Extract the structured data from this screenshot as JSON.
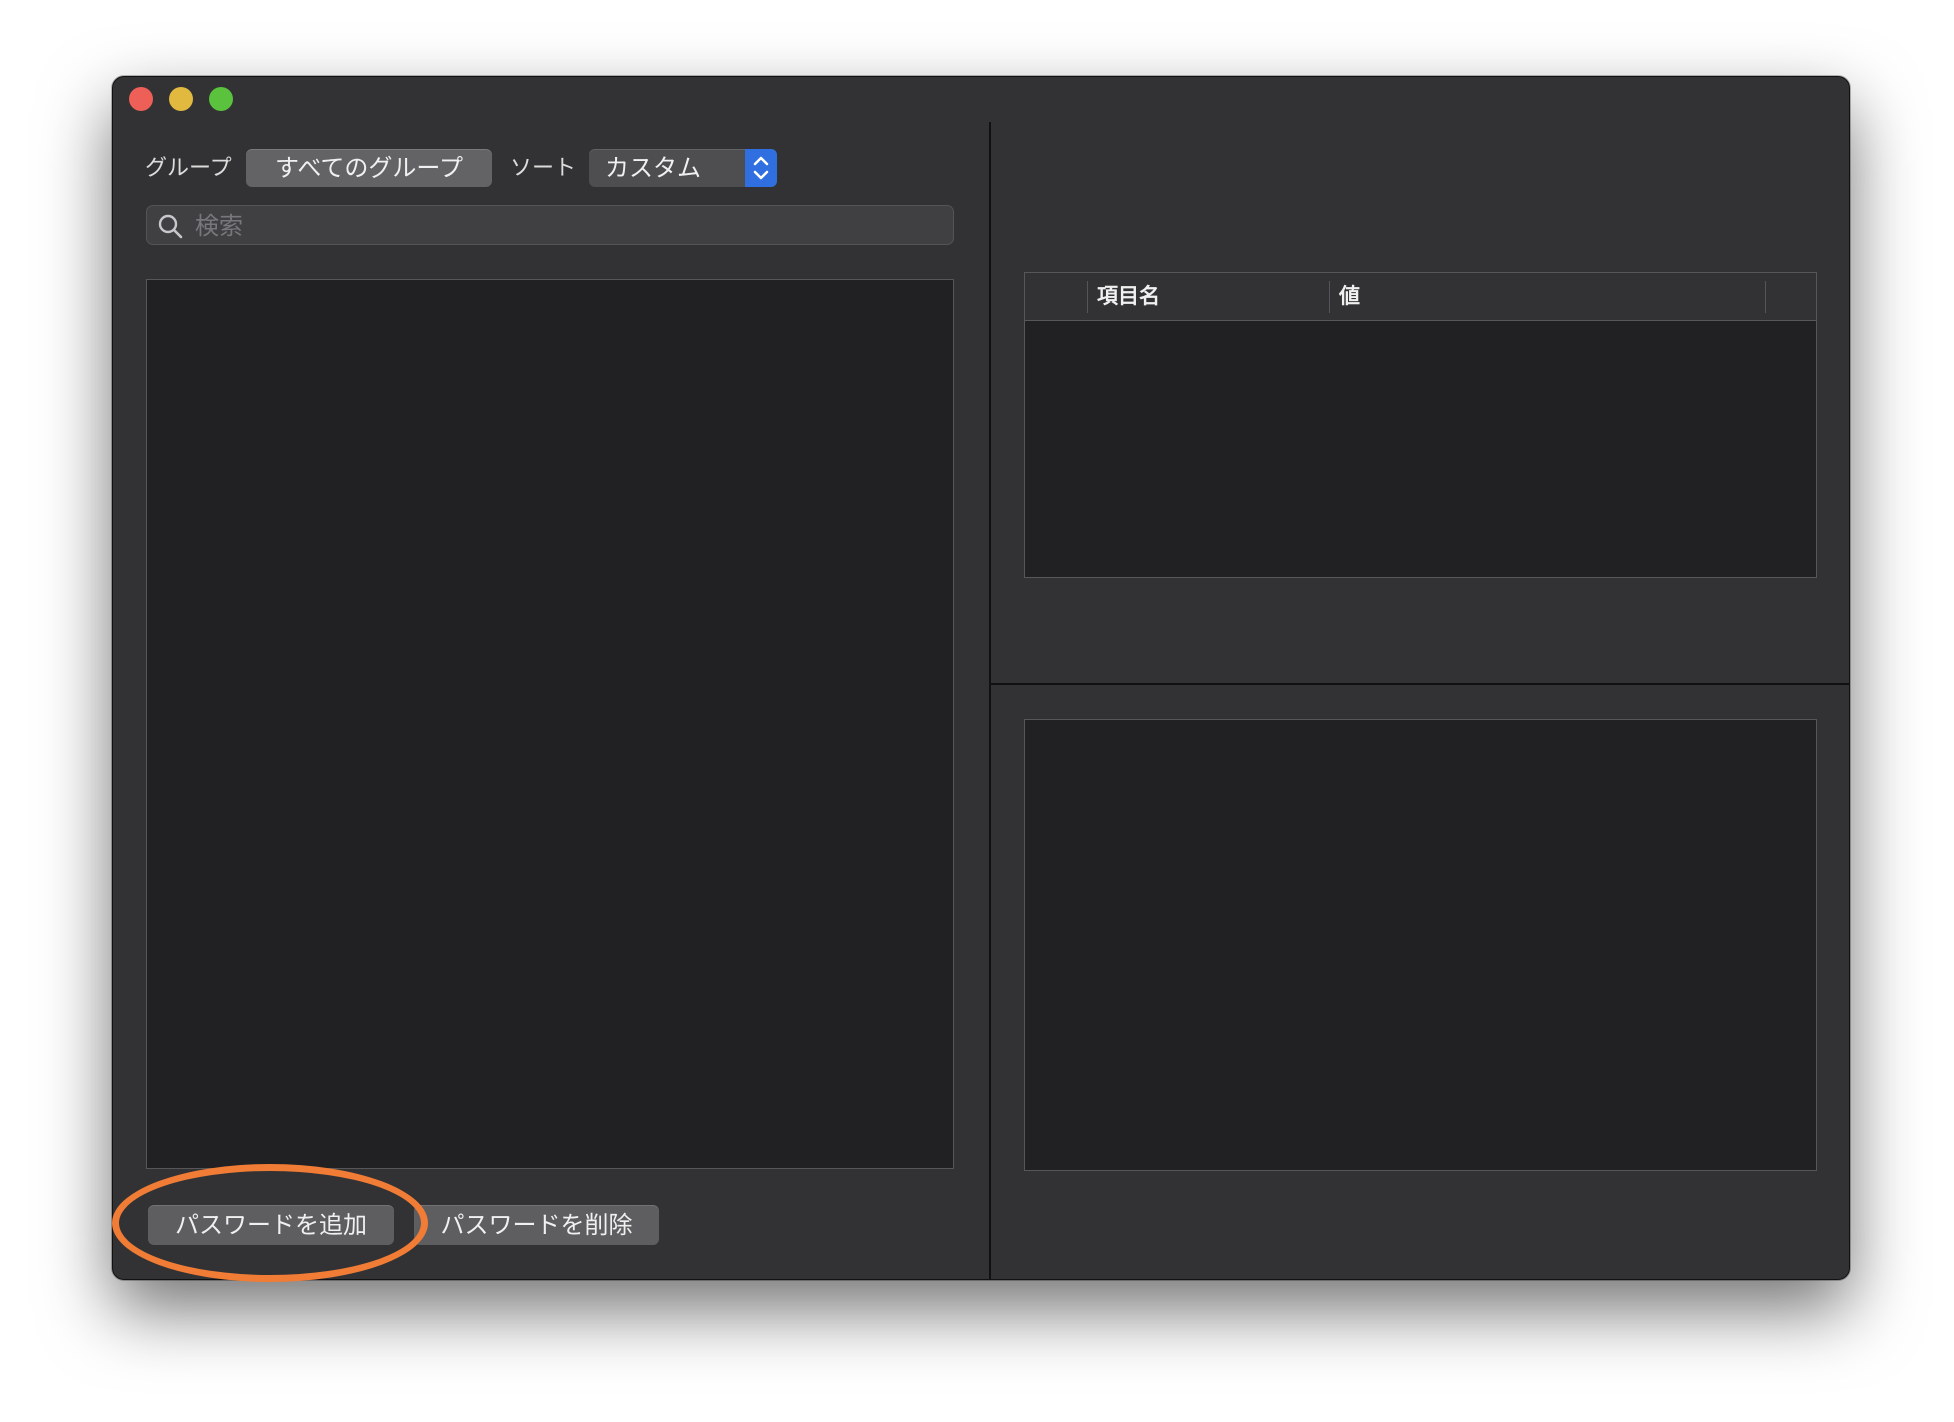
{
  "toolbar": {
    "group_label": "グループ",
    "group_button": "すべてのグループ",
    "sort_label": "ソート",
    "sort_value": "カスタム"
  },
  "search": {
    "placeholder": "検索",
    "value": ""
  },
  "actions": {
    "add_label": "パスワードを追加",
    "delete_label": "パスワードを削除"
  },
  "fields_table": {
    "columns": [
      "",
      "項目名",
      "値"
    ],
    "rows": []
  },
  "colors": {
    "accent": "#2f6fe0",
    "highlight": "#f07c36",
    "window_bg": "#323234",
    "pane_bg": "#212124"
  },
  "icons": {
    "search": "magnifier-icon",
    "stepper": "up-down-chevron-icon"
  }
}
